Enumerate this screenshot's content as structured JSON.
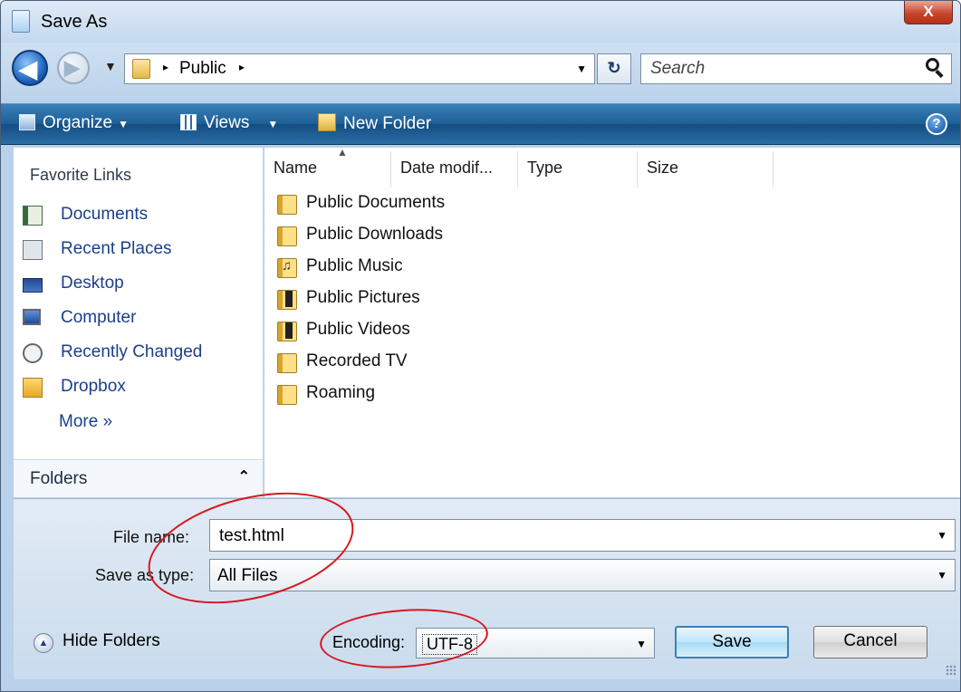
{
  "window": {
    "title": "Save As",
    "close_glyph": "X"
  },
  "nav": {
    "back_glyph": "◀",
    "forward_glyph": "▶",
    "history_glyph": "▼",
    "breadcrumb_sep": "▸",
    "breadcrumb": [
      "Public"
    ],
    "refresh_glyph": "↻",
    "search_placeholder": "Search"
  },
  "toolbar": {
    "organize_label": "Organize",
    "views_label": "Views",
    "new_folder_label": "New Folder",
    "caret": "▼",
    "help_glyph": "?"
  },
  "sidebar": {
    "favorites_header": "Favorite Links",
    "items": [
      {
        "label": "Documents",
        "icon": "documents-icon"
      },
      {
        "label": "Recent Places",
        "icon": "recent-places-icon"
      },
      {
        "label": "Desktop",
        "icon": "desktop-icon"
      },
      {
        "label": "Computer",
        "icon": "computer-icon"
      },
      {
        "label": "Recently Changed",
        "icon": "recently-changed-icon"
      },
      {
        "label": "Dropbox",
        "icon": "dropbox-icon"
      }
    ],
    "more_label": "More  »",
    "folders_label": "Folders",
    "folders_chevron": "⌃"
  },
  "file_list": {
    "columns": [
      "Name",
      "Date modif...",
      "Type",
      "Size"
    ],
    "sort_glyph": "▲",
    "items": [
      {
        "name": "Public Documents",
        "icon": "documents-folder-icon"
      },
      {
        "name": "Public Downloads",
        "icon": "folder-icon"
      },
      {
        "name": "Public Music",
        "icon": "music-folder-icon"
      },
      {
        "name": "Public Pictures",
        "icon": "pictures-folder-icon"
      },
      {
        "name": "Public Videos",
        "icon": "videos-folder-icon"
      },
      {
        "name": "Recorded TV",
        "icon": "folder-icon"
      },
      {
        "name": "Roaming",
        "icon": "folder-icon"
      }
    ]
  },
  "form": {
    "filename_label": "File name:",
    "filename_value": "test.html",
    "savetype_label": "Save as type:",
    "savetype_value": "All Files",
    "dropdown_glyph": "▼",
    "hide_folders_label": "Hide Folders",
    "hide_folders_glyph": "▲",
    "encoding_label": "Encoding:",
    "encoding_value": "UTF-8",
    "save_label": "Save",
    "cancel_label": "Cancel"
  },
  "colors": {
    "toolbar": "#1d5e96",
    "annotation": "#d8161e",
    "link": "#1b3f8a"
  }
}
